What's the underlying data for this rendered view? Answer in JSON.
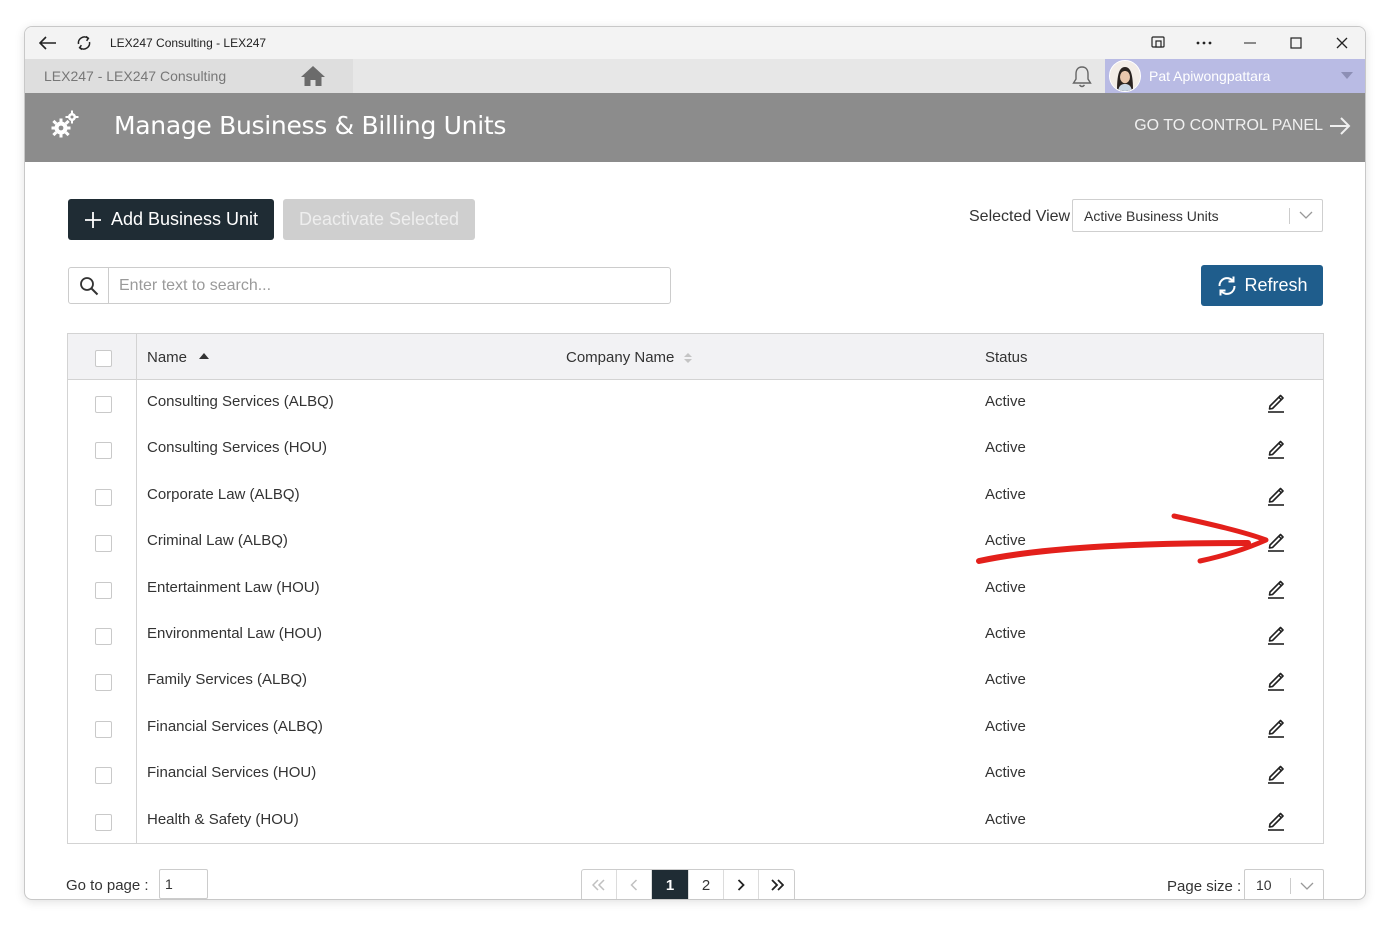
{
  "window": {
    "title": "LEX247 Consulting - LEX247",
    "back_icon": "back-arrow-icon",
    "reload_icon": "reload-icon"
  },
  "tabbar": {
    "tab_label": "LEX247  -  LEX247 Consulting",
    "user_name": "Pat Apiwongpattara"
  },
  "header": {
    "title": "Manage Business & Billing Units",
    "control_panel_link": "GO TO CONTROL PANEL"
  },
  "toolbar": {
    "add_label": "Add Business Unit",
    "deactivate_label": "Deactivate Selected",
    "selected_view_label": "Selected View",
    "selected_view_value": "Active Business Units",
    "search_placeholder": "Enter text to search...",
    "refresh_label": "Refresh"
  },
  "grid": {
    "columns": [
      "Name",
      "Company Name",
      "Status"
    ],
    "rows": [
      {
        "name": "Consulting Services (ALBQ)",
        "company": "",
        "status": "Active"
      },
      {
        "name": "Consulting Services (HOU)",
        "company": "",
        "status": "Active"
      },
      {
        "name": "Corporate Law (ALBQ)",
        "company": "",
        "status": "Active"
      },
      {
        "name": "Criminal Law (ALBQ)",
        "company": "",
        "status": "Active"
      },
      {
        "name": "Entertainment Law (HOU)",
        "company": "",
        "status": "Active"
      },
      {
        "name": "Environmental Law (HOU)",
        "company": "",
        "status": "Active"
      },
      {
        "name": "Family Services (ALBQ)",
        "company": "",
        "status": "Active"
      },
      {
        "name": "Financial Services (ALBQ)",
        "company": "",
        "status": "Active"
      },
      {
        "name": "Financial Services (HOU)",
        "company": "",
        "status": "Active"
      },
      {
        "name": "Health & Safety (HOU)",
        "company": "",
        "status": "Active"
      }
    ]
  },
  "footer": {
    "goto_label": "Go to page :",
    "goto_value": "1",
    "pages": [
      "1",
      "2"
    ],
    "current_page": "1",
    "page_size_label": "Page size :",
    "page_size_value": "10"
  },
  "colors": {
    "header_bg": "#8c8c8c",
    "primary_dark": "#1f2c34",
    "refresh_blue": "#1f5d8c",
    "user_tab_bg": "#b9bbe4",
    "annotation_red": "#e3201b"
  }
}
